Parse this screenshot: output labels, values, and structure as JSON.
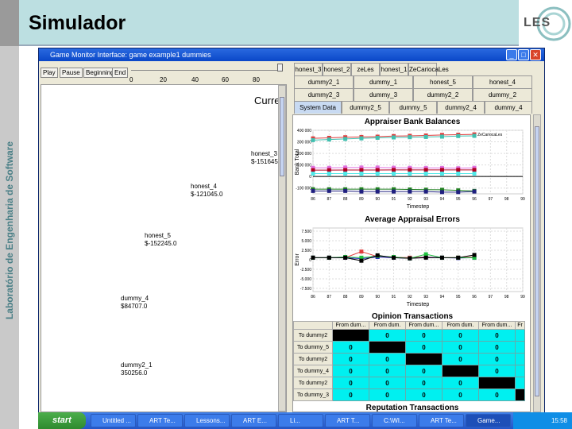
{
  "slide": {
    "title": "Simulador",
    "side_label": "Laboratório de Engenharia de Software",
    "logo": "LES"
  },
  "window": {
    "title": "Game Monitor Interface: game example1 dummies",
    "controls": [
      "minimize",
      "maximize",
      "close"
    ]
  },
  "playback": {
    "buttons": [
      "Play",
      "Pause",
      "Beginning",
      "End"
    ],
    "slider_ticks": [
      "0",
      "20",
      "40",
      "60",
      "80"
    ],
    "slider_value_percent": 100
  },
  "left_panel": {
    "heading": "Curre",
    "agents": [
      {
        "name": "honest_3",
        "balance": "$-151645"
      },
      {
        "name": "honest_4",
        "balance": "$-121045.0"
      },
      {
        "name": "honest_5",
        "balance": "$-152245.0"
      },
      {
        "name": "dummy_4",
        "balance": "$84707.0"
      },
      {
        "name": "dummy2_1",
        "balance": "350256.0"
      }
    ]
  },
  "tabs": {
    "row1": [
      "honest_3",
      "honest_2",
      "zeLes",
      "honest_1",
      "ZeCariocaLes"
    ],
    "row2": [
      "dummy2_1",
      "dummy_1",
      "honest_5",
      "honest_4"
    ],
    "row3": [
      "dummy2_3",
      "dummy_3",
      "dummy2_2",
      "dummy_2"
    ],
    "row4": [
      "System Data",
      "dummy2_5",
      "dummy_5",
      "dummy2_4",
      "dummy_4"
    ],
    "active": "System Data"
  },
  "chart_data": [
    {
      "type": "line",
      "title": "Appraiser Bank Balances",
      "xlabel": "Timestep",
      "ylabel": "Bank Total",
      "x_ticks": [
        "86",
        "87",
        "88",
        "89",
        "90",
        "91",
        "92",
        "93",
        "94",
        "95",
        "96",
        "97",
        "98",
        "99"
      ],
      "y_ticks": [
        "400 000",
        "300 000",
        "200 000",
        "100 000",
        "0",
        "-100 000"
      ],
      "ylim": [
        -150000,
        400000
      ],
      "legend_label": "ZeCariocaLes",
      "x": [
        86,
        87,
        88,
        89,
        90,
        91,
        92,
        93,
        94,
        95,
        96
      ],
      "series": [
        {
          "color": "#e03c3c",
          "values": [
            330000,
            335000,
            340000,
            342000,
            345000,
            350000,
            352000,
            355000,
            360000,
            362000,
            365000
          ]
        },
        {
          "color": "#40c0b0",
          "values": [
            315000,
            320000,
            325000,
            330000,
            335000,
            338000,
            340000,
            342000,
            345000,
            350000,
            352000
          ]
        },
        {
          "color": "#e070e0",
          "values": [
            75000,
            75000,
            78000,
            78000,
            78000,
            76000,
            75000,
            74000,
            74000,
            72000,
            75000
          ]
        },
        {
          "color": "#b00020",
          "values": [
            55000,
            55000,
            56000,
            56000,
            56000,
            57000,
            57000,
            57000,
            57000,
            57000,
            57000
          ]
        },
        {
          "color": "#50e8e8",
          "values": [
            25000,
            25000,
            25000,
            25000,
            25000,
            25000,
            25000,
            25000,
            25000,
            25000,
            25000
          ]
        },
        {
          "color": "#208020",
          "values": [
            -110000,
            -110000,
            -110000,
            -110000,
            -110000,
            -110000,
            -112000,
            -114000,
            -115000,
            -120000,
            -125000
          ]
        },
        {
          "color": "#202080",
          "values": [
            -125000,
            -125000,
            -125000,
            -130000,
            -130000,
            -130000,
            -130000,
            -130000,
            -135000,
            -135000,
            -130000
          ]
        }
      ]
    },
    {
      "type": "line",
      "title": "Average Appraisal Errors",
      "xlabel": "Timestep",
      "ylabel": "Error",
      "x_ticks": [
        "86",
        "87",
        "88",
        "89",
        "90",
        "91",
        "92",
        "93",
        "94",
        "95",
        "96",
        "97",
        "98",
        "99"
      ],
      "y_ticks": [
        "7.500",
        "5.000",
        "2.500",
        "0",
        "-2.500",
        "-5.000",
        "-7.500"
      ],
      "ylim": [
        -10000,
        8750
      ],
      "x": [
        86,
        87,
        88,
        89,
        90,
        91,
        92,
        93,
        94,
        95,
        96
      ],
      "series": [
        {
          "color": "#e03c3c",
          "values": [
            0,
            0,
            0,
            1800,
            300,
            100,
            0,
            200,
            0,
            0,
            200
          ]
        },
        {
          "color": "#2020c0",
          "values": [
            0,
            0,
            0,
            -300,
            200,
            0,
            -200,
            100,
            0,
            -100,
            0
          ]
        },
        {
          "color": "#20c040",
          "values": [
            0,
            0,
            200,
            0,
            500,
            200,
            -200,
            1000,
            0,
            0,
            0
          ]
        },
        {
          "color": "#000000",
          "values": [
            0,
            0,
            0,
            -900,
            700,
            0,
            -200,
            0,
            0,
            0,
            800
          ]
        }
      ]
    }
  ],
  "opinion_table": {
    "title": "Opinion Transactions",
    "columns": [
      "From dum...",
      "From dum.",
      "From dum...",
      "From dum.",
      "From dum...",
      "Fr"
    ],
    "rows": [
      {
        "label": "To dummy2",
        "cells": [
          "",
          "0",
          "0",
          "0",
          "0"
        ],
        "diag": 0
      },
      {
        "label": "To dummy_5",
        "cells": [
          "0",
          "",
          "0",
          "0",
          "0"
        ],
        "diag": 1
      },
      {
        "label": "To dummy2",
        "cells": [
          "0",
          "0",
          "",
          "0",
          "0"
        ],
        "diag": 2
      },
      {
        "label": "To dummy_4",
        "cells": [
          "0",
          "0",
          "0",
          "",
          "0"
        ],
        "diag": 3
      },
      {
        "label": "To dummy2",
        "cells": [
          "0",
          "0",
          "0",
          "0",
          ""
        ],
        "diag": 4
      },
      {
        "label": "To dummy_3",
        "cells": [
          "0",
          "0",
          "0",
          "0",
          "0"
        ],
        "diag": 5
      }
    ]
  },
  "reputation_title": "Reputation Transactions",
  "taskbar": {
    "start": "start",
    "items": [
      "Untitled ...",
      "ART Te...",
      "Lessons...",
      "ART E...",
      "Li...",
      "ART T...",
      "C:\\WI...",
      "ART Te...",
      "Game..."
    ],
    "clock": "15:58"
  },
  "colors": {
    "header": "#bcdfe1",
    "titlebar": "#0a47c8",
    "cell": "#00f0f0",
    "taskbar": "#2456c8"
  }
}
